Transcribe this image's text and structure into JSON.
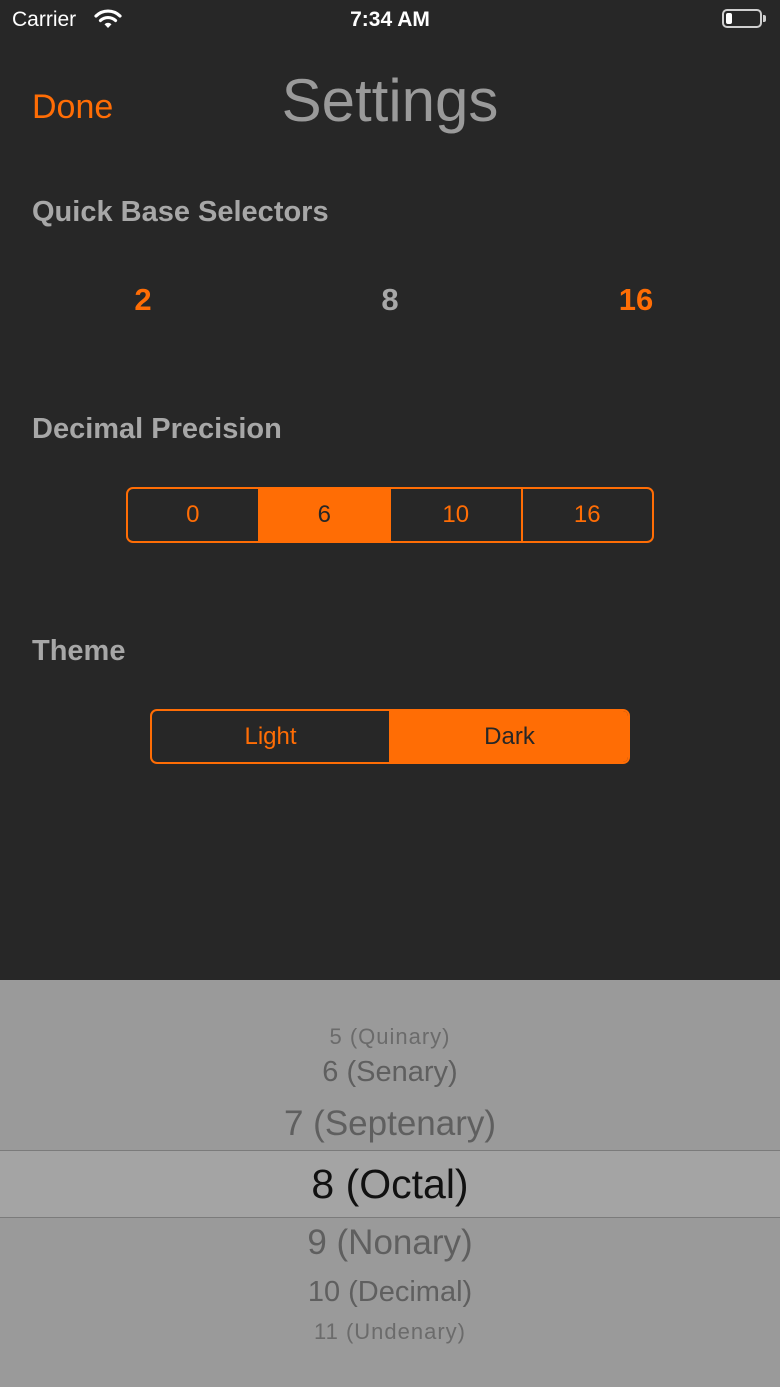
{
  "status_bar": {
    "carrier": "Carrier",
    "time": "7:34 AM",
    "battery_level": 0.2
  },
  "nav": {
    "done": "Done",
    "title": "Settings"
  },
  "quick_base": {
    "label": "Quick Base Selectors",
    "bases": [
      {
        "value": "2",
        "color": "#ff6d05"
      },
      {
        "value": "8",
        "color": "#a7a7a7"
      },
      {
        "value": "16",
        "color": "#ff6d05"
      }
    ]
  },
  "decimal_precision": {
    "label": "Decimal Precision",
    "options": [
      "0",
      "6",
      "10",
      "16"
    ],
    "selected": "6"
  },
  "theme": {
    "label": "Theme",
    "options": [
      "Light",
      "Dark"
    ],
    "selected": "Dark"
  },
  "picker": {
    "items": [
      "5 (Quinary)",
      "6 (Senary)",
      "7 (Septenary)",
      "8 (Octal)",
      "9 (Nonary)",
      "10 (Decimal)",
      "11 (Undenary)"
    ],
    "selected": "8 (Octal)"
  },
  "colors": {
    "accent": "#ff6d05",
    "background": "#272727",
    "picker_bg": "#9a9a9a"
  },
  "icons": {
    "wifi": "wifi-icon",
    "battery": "battery-icon"
  }
}
